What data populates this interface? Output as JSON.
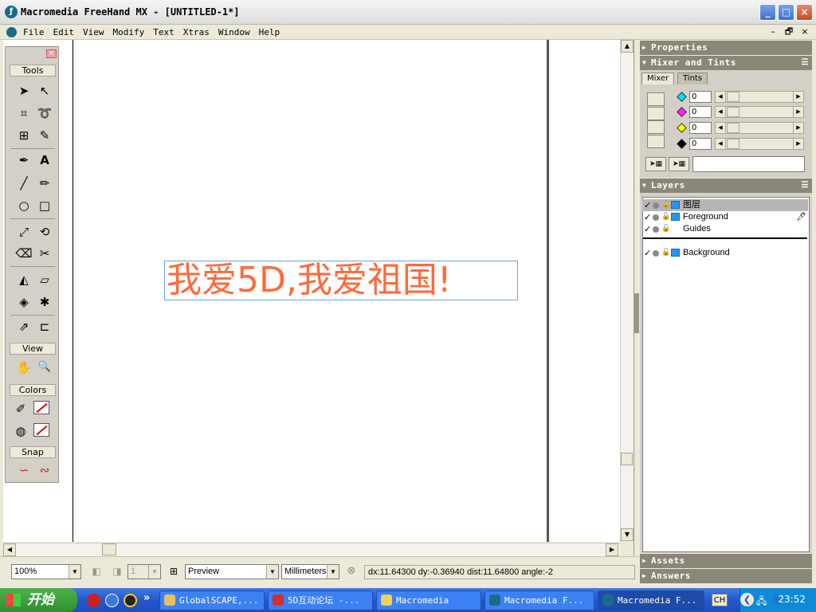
{
  "window": {
    "title": "Macromedia FreeHand MX - [UNTITLED-1*]",
    "minimize": "_",
    "maximize": "□",
    "close": "×"
  },
  "menu": {
    "items": [
      "File",
      "Edit",
      "View",
      "Modify",
      "Text",
      "Xtras",
      "Window",
      "Help"
    ],
    "doc_min": "–",
    "doc_restore": "🗗",
    "doc_close": "×"
  },
  "canvas": {
    "text": "我爱5D,我爱祖国!",
    "text_color": "#ff6a3a"
  },
  "tools_panel": {
    "close": "×",
    "sections": {
      "tools": "Tools",
      "view": "View",
      "colors": "Colors",
      "snap": "Snap"
    },
    "icons": {
      "pointer": "➤",
      "subselect": "↖",
      "page": "⌗",
      "lasso": "➰",
      "trace": "⊞",
      "eyedropper": "✎",
      "pen": "✒",
      "text": "A",
      "line": "╱",
      "pencil": "✏",
      "ellipse": "○",
      "rectangle": "□",
      "scale": "⤢",
      "reflect": "⟲",
      "eraser": "⌫",
      "knife": "✂",
      "perspective": "◭",
      "extrude": "▱",
      "bevel": "◈",
      "blend": "✱",
      "link": "⇗",
      "connector": "⊏",
      "hand": "✋",
      "zoom": "🔍",
      "stroke": "✐",
      "fill": "◍",
      "snap1": "∽",
      "snap2": "∾"
    }
  },
  "panels": {
    "properties": "Properties",
    "mixer_and_tints": "Mixer and Tints",
    "mixer_tab": "Mixer",
    "tints_tab": "Tints",
    "mixer_values": [
      "0",
      "0",
      "0",
      "0"
    ],
    "mixer_colors": [
      "#00e0ff",
      "#ff20ff",
      "#ffff00",
      "#000000"
    ],
    "layers": "Layers",
    "assets": "Assets",
    "answers": "Answers",
    "layer_items": [
      {
        "name": "图层",
        "selected": true
      },
      {
        "name": "Foreground",
        "selected": false
      },
      {
        "name": "Guides",
        "selected": false
      }
    ],
    "background_layer": "Background",
    "check": "✓",
    "lock": "🔓",
    "pen": "🖊"
  },
  "statusbar": {
    "zoom": "100%",
    "page": "1",
    "view_mode": "Preview",
    "units": "Millimeters",
    "readout": "dx:11.64300  dy:-0.36940  dist:11.64800  angle:-2"
  },
  "taskbar": {
    "start": "开始",
    "more": "»",
    "tasks": [
      {
        "label": "GlobalSCAPE,...",
        "icon_color": "#e8c060"
      },
      {
        "label": "5D互动论坛 -...",
        "icon_color": "#d03030"
      },
      {
        "label": "Macromedia",
        "icon_color": "#f0d060"
      },
      {
        "label": "Macromedia F...",
        "icon_color": "#1a6b8a"
      },
      {
        "label": "Macromedia F...",
        "icon_color": "#1a6b8a"
      }
    ],
    "lang": "CH",
    "clock": "23:52"
  }
}
